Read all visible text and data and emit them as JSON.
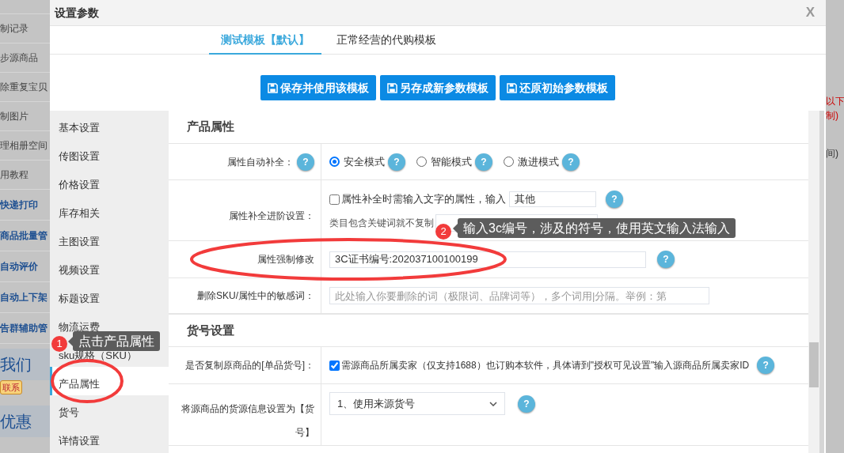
{
  "background": {
    "left_items": [
      {
        "text": "制记录",
        "kind": "plain"
      },
      {
        "text": "步源商品",
        "kind": "plain"
      },
      {
        "text": "除重复宝贝",
        "kind": "plain"
      },
      {
        "text": "制图片",
        "kind": "plain"
      },
      {
        "text": "理相册空间",
        "kind": "plain"
      },
      {
        "text": "用教程",
        "kind": "plain"
      },
      {
        "text": "快递打印",
        "kind": "bold"
      },
      {
        "text": "商品批量管",
        "kind": "bold"
      },
      {
        "text": "自动评价",
        "kind": "bold"
      },
      {
        "text": "自动上下架",
        "kind": "bold"
      },
      {
        "text": "告群辅助管",
        "kind": "bold"
      },
      {
        "text": "我们",
        "kind": "large"
      },
      {
        "text": "联系",
        "kind": "badge"
      },
      {
        "text": "优惠",
        "kind": "large"
      }
    ],
    "right_items": [
      {
        "text": "以下",
        "kind": "red"
      },
      {
        "text": "制)",
        "kind": "red"
      },
      {
        "text": "间)",
        "kind": "plain"
      }
    ]
  },
  "dialog": {
    "title": "设置参数",
    "close": "X"
  },
  "tabs": [
    {
      "label": "测试模板【默认】",
      "selected": true
    },
    {
      "label": "正常经营的代购模板",
      "selected": false
    }
  ],
  "actions": [
    "保存并使用该模板",
    "另存成新参数模板",
    "还原初始参数模板"
  ],
  "sidebar": [
    {
      "label": "基本设置",
      "selected": false
    },
    {
      "label": "传图设置",
      "selected": false
    },
    {
      "label": "价格设置",
      "selected": false
    },
    {
      "label": "库存相关",
      "selected": false
    },
    {
      "label": "主图设置",
      "selected": false
    },
    {
      "label": "视频设置",
      "selected": false
    },
    {
      "label": "标题设置",
      "selected": false
    },
    {
      "label": "物流运费",
      "selected": false
    },
    {
      "label": "sku规格（SKU）",
      "selected": false
    },
    {
      "label": "产品属性",
      "selected": true
    },
    {
      "label": "货号",
      "selected": false
    },
    {
      "label": "详情设置",
      "selected": false
    }
  ],
  "sections": [
    {
      "title": "产品属性",
      "rows": [
        {
          "kind": "radio",
          "label": "属性自动补全：",
          "help": "?",
          "options": [
            {
              "label": "安全模式",
              "selected": true,
              "help": "?"
            },
            {
              "label": "智能模式",
              "selected": false,
              "help": "?"
            },
            {
              "label": "激进模式",
              "selected": false,
              "help": "?"
            }
          ]
        },
        {
          "kind": "advanced",
          "label": "属性补全进阶设置：",
          "checked": false,
          "text": "属性补全时需输入文字的属性，输入",
          "value": "其他",
          "help": "?",
          "keyword_label": "类目包含关键词就不复制"
        },
        {
          "kind": "text",
          "label": "属性强制修改",
          "value": "3C证书编号:202037100100199",
          "help": "?"
        },
        {
          "kind": "placeholder",
          "label": "删除SKU/属性中的敏感词：",
          "placeholder": "此处输入你要删除的词（极限词、品牌词等），多个词用|分隔。举例：第"
        }
      ]
    },
    {
      "title": "货号设置",
      "rows": [
        {
          "kind": "checkbox",
          "label": "是否复制原商品的[单品货号]：",
          "checked": true,
          "text": "需源商品所属卖家（仅支持1688）也订购本软件，具体请到\"授权可见设置\"输入源商品所属卖家ID",
          "help": "?"
        },
        {
          "kind": "select",
          "label": "将源商品的货源信息设置为【货号】",
          "value": "1、使用来源货号",
          "help": "?"
        }
      ]
    }
  ],
  "annotations": [
    {
      "number": "1",
      "text": "点击产品属性"
    },
    {
      "number": "2",
      "text": "输入3c编号，涉及的符号，使用英文输入法输入"
    }
  ]
}
